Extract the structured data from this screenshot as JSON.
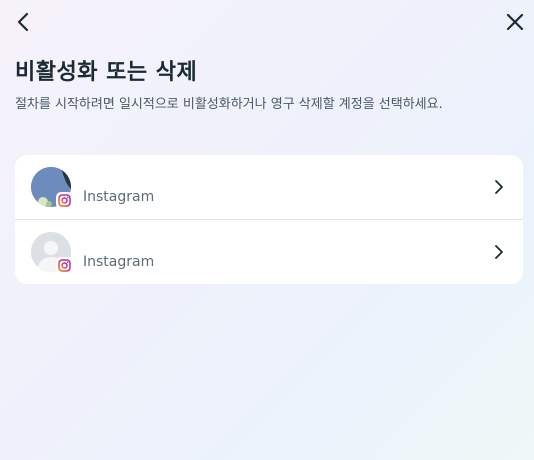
{
  "header": {
    "back_icon": "chevron-left-icon",
    "close_icon": "close-icon",
    "title": "비활성화 또는 삭제",
    "subtitle": "절차를 시작하려면 일시적으로 비활성화하거나 영구 삭제할 계정을 선택하세요."
  },
  "accounts": [
    {
      "name": "",
      "platform": "Instagram",
      "avatar": "profile-photo",
      "badge_icon": "instagram-icon",
      "action_icon": "chevron-right-icon"
    },
    {
      "name": "",
      "platform": "Instagram",
      "avatar": "default-avatar",
      "badge_icon": "instagram-icon",
      "action_icon": "chevron-right-icon"
    }
  ],
  "colors": {
    "title": "#1c2b33",
    "subtitle": "#465a69",
    "card": "#ffffff",
    "instagram_gradient": [
      "#feda75",
      "#fa7e1e",
      "#d62976",
      "#962fbf"
    ]
  }
}
